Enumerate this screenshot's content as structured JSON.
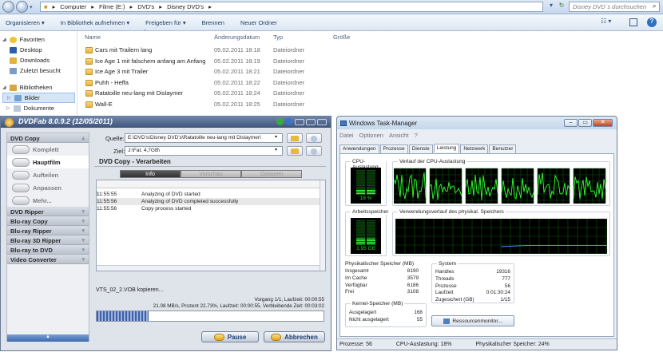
{
  "explorer": {
    "breadcrumb": [
      "Computer",
      "Filme (E:)",
      "DVD's",
      "Disney DVD's"
    ],
    "search_placeholder": "Disney DVD´s durchsuchen",
    "toolbar": [
      "Organisieren ▾",
      "In Bibliothek aufnehmen ▾",
      "Freigeben für ▾",
      "Brennen",
      "Neuer Ordner"
    ],
    "nav": [
      {
        "label": "Favoriten",
        "icon": "star-icon"
      },
      {
        "label": "Desktop",
        "icon": "desktop-icon"
      },
      {
        "label": "Downloads",
        "icon": "downloads-icon"
      },
      {
        "label": "Zuletzt besucht",
        "icon": "recent-icon"
      },
      {
        "label": "Bibliotheken",
        "icon": "library-icon"
      },
      {
        "label": "Bilder",
        "icon": "pictures-icon"
      },
      {
        "label": "Dokumente",
        "icon": "documents-icon"
      }
    ],
    "columns": [
      "Name",
      "Änderungsdatum",
      "Typ",
      "Größe"
    ],
    "files": [
      {
        "name": "Cars mit Trailern lang",
        "date": "05.02.2011 18:18",
        "type": "Dateiordner"
      },
      {
        "name": "Ice Age 1 mit falschem anfang am Anfang",
        "date": "05.02.2011 18:19",
        "type": "Dateiordner"
      },
      {
        "name": "Ice Age 3 mit Trailer",
        "date": "05.02.2011 18:21",
        "type": "Dateiordner"
      },
      {
        "name": "Puhh - Heffa",
        "date": "05.02.2011 18:22",
        "type": "Dateiordner"
      },
      {
        "name": "Ratatoille neu-lang mit Dislaymer",
        "date": "05.02.2011 18:24",
        "type": "Dateiordner"
      },
      {
        "name": "Wall-E",
        "date": "05.02.2011 18:25",
        "type": "Dateiordner"
      }
    ]
  },
  "dvdfab": {
    "title": "DVDFab 8.0.9.2 (12/05/2011)",
    "categories": {
      "dvd_copy": "DVD Copy",
      "modes": [
        "Komplett",
        "Hauptfilm",
        "Aufteilen",
        "Anpassen",
        "Mehr..."
      ],
      "others": [
        "DVD Ripper",
        "Blu-ray Copy",
        "Blu-ray Ripper",
        "Blu-ray 3D Ripper",
        "Blu-ray to DVD",
        "Video Converter"
      ]
    },
    "source_label": "Quelle:",
    "source_value": "E:\\DVD's\\Disney DVD's\\Ratatoille neu-lang mit Dislaymer\\",
    "target_label": "Ziel:",
    "target_value": "J:\\Fat. 4,7GB\\",
    "section_title": "DVD Copy - Verarbeiten",
    "tabs": [
      "Info",
      "Vorschau",
      "Optionen"
    ],
    "log": [
      {
        "time": "11:55:55",
        "msg": "Analyzing of DVD started"
      },
      {
        "time": "11:55:56",
        "msg": "Analyzing of DVD completed successfully"
      },
      {
        "time": "11:55:56",
        "msg": "Copy process started"
      }
    ],
    "current_file": "VTS_02_2.VOB kopieren...",
    "progress_line1": "Vorgang 1/1, Laufzeit: 00:00:55",
    "progress_line2": "21.08 MB/s, Prozent 22.73%,  Laufzeit: 00:00:55,  Verbleibende Zeit: 00:03:02",
    "progress_percent": 22.73,
    "pause_label": "Pause",
    "abort_label": "Abbrechen"
  },
  "taskmanager": {
    "title": "Windows Task-Manager",
    "menu": [
      "Datei",
      "Optionen",
      "Ansicht",
      "?"
    ],
    "tabs": [
      "Anwendungen",
      "Prozesse",
      "Dienste",
      "Leistung",
      "Netzwerk",
      "Benutzer"
    ],
    "active_tab": "Leistung",
    "cpu_label": "CPU-Auslastung",
    "cpu_history_label": "Verlauf der CPU-Auslastung",
    "cpu_value": "18 %",
    "cpu_percent": 18,
    "mem_label": "Arbeitsspeicher",
    "mem_history_label": "Verwendungsverlauf des physikal. Speichers",
    "mem_value": "1,95 GB",
    "mem_fraction": 0.24,
    "phys_title": "Physikalischer Speicher (MB)",
    "phys": [
      [
        "Insgesamt",
        "8190"
      ],
      [
        "Im Cache",
        "3579"
      ],
      [
        "Verfügbar",
        "6186"
      ],
      [
        "Frei",
        "3108"
      ]
    ],
    "kernel_title": "Kernel-Speicher (MB)",
    "kernel": [
      [
        "Ausgelagert",
        "168"
      ],
      [
        "Nicht ausgelagert",
        "55"
      ]
    ],
    "system_title": "System",
    "system": [
      [
        "Handles",
        "19316"
      ],
      [
        "Threads",
        "777"
      ],
      [
        "Prozesse",
        "56"
      ],
      [
        "Laufzeit",
        "0:01:30:24"
      ],
      [
        "Zugesichert (GB)",
        "1/15"
      ]
    ],
    "resmon_label": "Ressourcenmonitor...",
    "status": [
      "Prozesse: 56",
      "CPU-Auslastung: 18%",
      "Physikalischer Speicher: 24%"
    ]
  }
}
